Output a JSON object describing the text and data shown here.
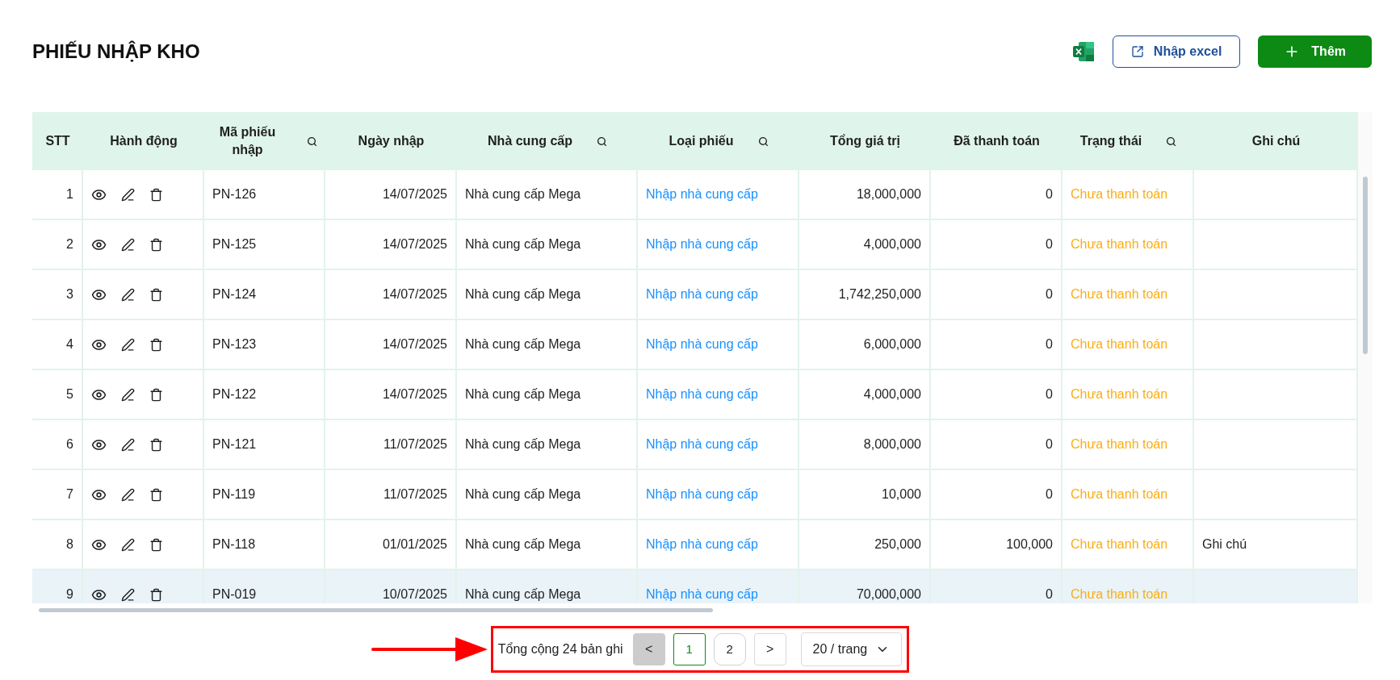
{
  "page_title": "PHIẾU NHẬP KHO",
  "toolbar": {
    "import_button": "Nhập excel",
    "add_button": "Thêm"
  },
  "table": {
    "columns": [
      {
        "label": "STT",
        "searchable": false
      },
      {
        "label": "Hành động",
        "searchable": false
      },
      {
        "label": "Mã phiếu nhập",
        "searchable": true
      },
      {
        "label": "Ngày nhập",
        "searchable": false
      },
      {
        "label": "Nhà cung cấp",
        "searchable": true
      },
      {
        "label": "Loại phiếu",
        "searchable": true
      },
      {
        "label": "Tổng giá trị",
        "searchable": false
      },
      {
        "label": "Đã thanh toán",
        "searchable": false
      },
      {
        "label": "Trạng thái",
        "searchable": true
      },
      {
        "label": "Ghi chú",
        "searchable": false
      }
    ],
    "rows": [
      {
        "stt": "1",
        "code": "PN-126",
        "date": "14/07/2025",
        "supplier": "Nhà cung cấp Mega",
        "type": "Nhập nhà cung cấp",
        "total": "18,000,000",
        "paid": "0",
        "status": "Chưa thanh toán",
        "note": "",
        "selected": false
      },
      {
        "stt": "2",
        "code": "PN-125",
        "date": "14/07/2025",
        "supplier": "Nhà cung cấp Mega",
        "type": "Nhập nhà cung cấp",
        "total": "4,000,000",
        "paid": "0",
        "status": "Chưa thanh toán",
        "note": "",
        "selected": false
      },
      {
        "stt": "3",
        "code": "PN-124",
        "date": "14/07/2025",
        "supplier": "Nhà cung cấp Mega",
        "type": "Nhập nhà cung cấp",
        "total": "1,742,250,000",
        "paid": "0",
        "status": "Chưa thanh toán",
        "note": "",
        "selected": false
      },
      {
        "stt": "4",
        "code": "PN-123",
        "date": "14/07/2025",
        "supplier": "Nhà cung cấp Mega",
        "type": "Nhập nhà cung cấp",
        "total": "6,000,000",
        "paid": "0",
        "status": "Chưa thanh toán",
        "note": "",
        "selected": false
      },
      {
        "stt": "5",
        "code": "PN-122",
        "date": "14/07/2025",
        "supplier": "Nhà cung cấp Mega",
        "type": "Nhập nhà cung cấp",
        "total": "4,000,000",
        "paid": "0",
        "status": "Chưa thanh toán",
        "note": "",
        "selected": false
      },
      {
        "stt": "6",
        "code": "PN-121",
        "date": "11/07/2025",
        "supplier": "Nhà cung cấp Mega",
        "type": "Nhập nhà cung cấp",
        "total": "8,000,000",
        "paid": "0",
        "status": "Chưa thanh toán",
        "note": "",
        "selected": false
      },
      {
        "stt": "7",
        "code": "PN-119",
        "date": "11/07/2025",
        "supplier": "Nhà cung cấp Mega",
        "type": "Nhập nhà cung cấp",
        "total": "10,000",
        "paid": "0",
        "status": "Chưa thanh toán",
        "note": "",
        "selected": false
      },
      {
        "stt": "8",
        "code": "PN-118",
        "date": "01/01/2025",
        "supplier": "Nhà cung cấp Mega",
        "type": "Nhập nhà cung cấp",
        "total": "250,000",
        "paid": "100,000",
        "status": "Chưa thanh toán",
        "note": "Ghi chú",
        "selected": false
      },
      {
        "stt": "9",
        "code": "PN-019",
        "date": "10/07/2025",
        "supplier": "Nhà cung cấp Mega",
        "type": "Nhập nhà cung cấp",
        "total": "70,000,000",
        "paid": "0",
        "status": "Chưa thanh toán",
        "note": "",
        "selected": true
      }
    ]
  },
  "pagination": {
    "total": "Tổng cộng 24 bản ghi",
    "prev": "<",
    "next": ">",
    "prev_disabled": true,
    "pages": [
      {
        "label": "1",
        "selected": true
      },
      {
        "label": "2",
        "selected": false
      }
    ],
    "page_size": "20 / trang"
  }
}
